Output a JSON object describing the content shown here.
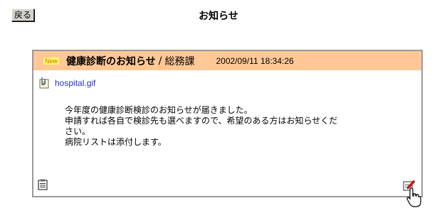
{
  "toolbar": {
    "back_label": "戻る"
  },
  "page": {
    "title": "お知らせ"
  },
  "notice": {
    "badge": "New",
    "title": "健康診断のお知らせ",
    "separator": "/",
    "department": "総務課",
    "datetime": "2002/09/11 18:34:26",
    "attachment": "hospital.gif",
    "body_lines": [
      "今年度の健康診断検診のお知らせが届きました。",
      "申請すれば各自で検診先も選べますので、希望のある方はお知らせくだ",
      "さい。",
      "病院リストは添付します。"
    ]
  },
  "colors": {
    "header_bg": "#ffc896",
    "link": "#2233cc",
    "border": "#9a9a9a"
  },
  "icons": {
    "attachment": "attachment-clip-icon",
    "bottom_left": "notepad-icon",
    "bottom_right": "edit-pencil-icon",
    "cursor": "hand-pointer-icon"
  }
}
